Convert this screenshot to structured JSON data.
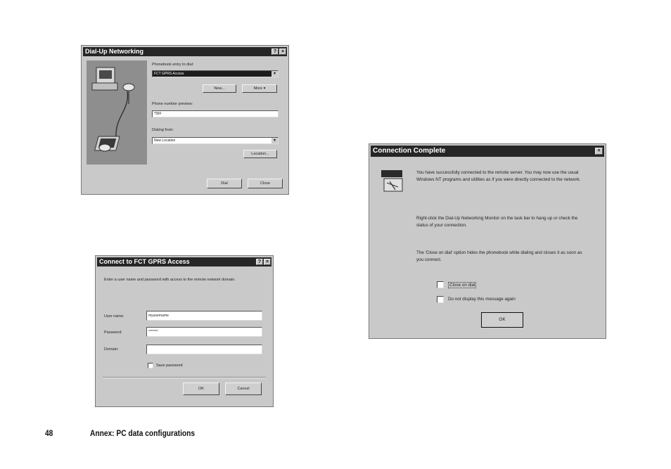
{
  "dialup": {
    "title": "Dial-Up Networking",
    "phonebook_label": "Phonebook entry to dial:",
    "phonebook_value": "FCT GPRS Access",
    "new_button": "New...",
    "more_button": "More ▾",
    "phone_label": "Phone number preview:",
    "phone_value": "*99#",
    "dialing_label": "Dialing from:",
    "dialing_value": "New Location",
    "location_button": "Location...",
    "dial_button": "Dial",
    "close_button": "Close"
  },
  "connect": {
    "title": "Connect to FCT GPRS Access",
    "instruction": "Enter a user name and password with access to the remote network domain.",
    "username_label": "User name:",
    "username_value": "myusername",
    "password_label": "Password:",
    "password_value": "*******",
    "domain_label": "Domain:",
    "domain_value": "",
    "save_password_label": "Save password",
    "ok_button": "OK",
    "cancel_button": "Cancel"
  },
  "complete": {
    "title": "Connection Complete",
    "paragraph1": "You have successfully connected to the remote server. You may now use the usual Windows NT programs and utilities as if you were directly connected to the network.",
    "paragraph2": "Right-click the Dial-Up Networking Monitor on the task bar to hang up or check the status of your connection.",
    "paragraph3": "The 'Close on dial' option hides the phonebook while dialing and closes it as soon as you connect.",
    "close_on_dial_label": "Close on dial",
    "do_not_display_label": "Do not display this message again",
    "ok_button": "OK"
  },
  "footer": {
    "page_number": "48",
    "section_title": "Annex: PC data configurations"
  }
}
